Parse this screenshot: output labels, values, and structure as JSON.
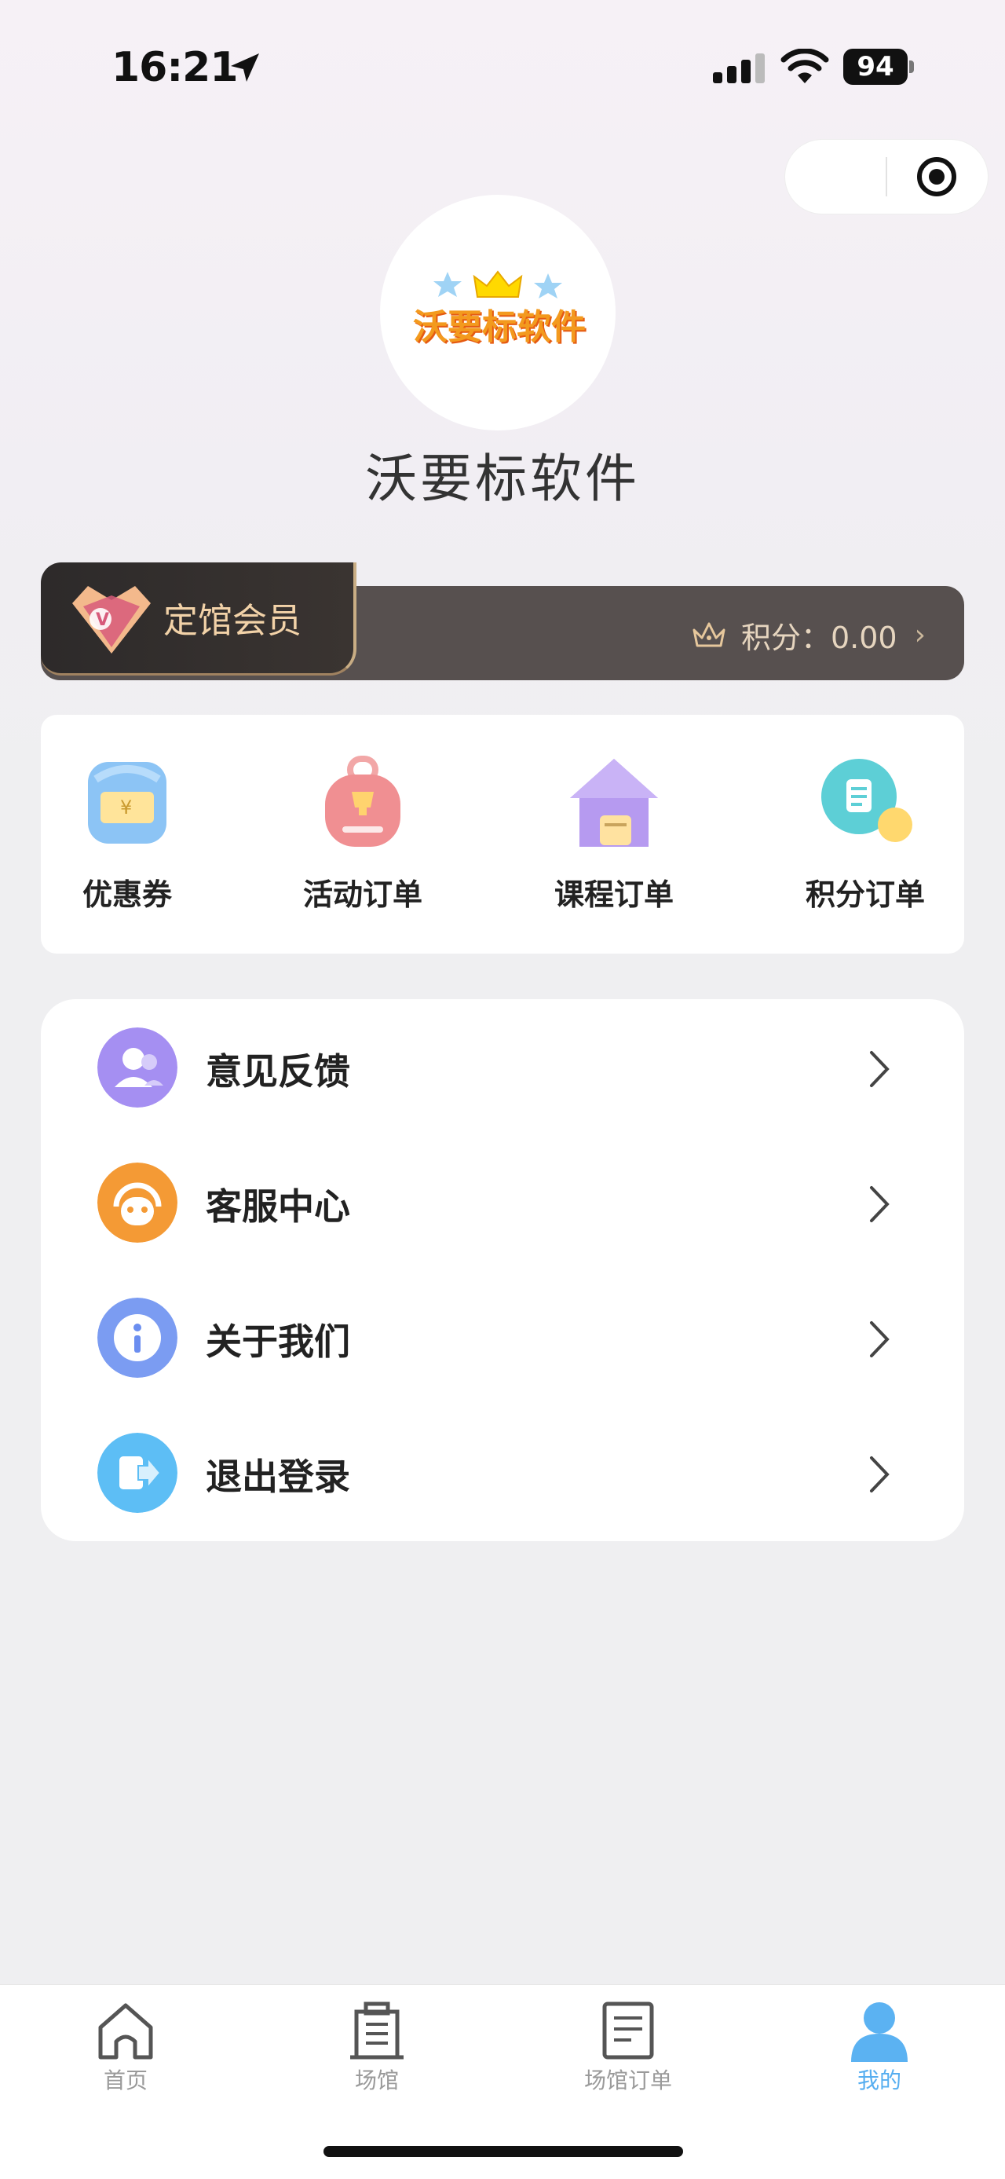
{
  "status_bar": {
    "time": "16:21",
    "battery": "94"
  },
  "header": {
    "app_name": "沃要标软件",
    "logo_text": "沃要标软件"
  },
  "member": {
    "title": "定馆会员",
    "points": "积分：0.00"
  },
  "quick_menu": [
    {
      "label": "优惠券",
      "icon": "coupon-icon"
    },
    {
      "label": "活动订单",
      "icon": "activity-order-icon"
    },
    {
      "label": "课程订单",
      "icon": "course-order-icon"
    },
    {
      "label": "积分订单",
      "icon": "points-order-icon"
    }
  ],
  "menu_list": [
    {
      "label": "意见反馈",
      "icon": "feedback-icon"
    },
    {
      "label": "客服中心",
      "icon": "customer-service-icon"
    },
    {
      "label": "关于我们",
      "icon": "info-icon"
    },
    {
      "label": "退出登录",
      "icon": "logout-icon"
    }
  ],
  "tabbar": [
    {
      "label": "首页",
      "icon": "home-icon",
      "active": false
    },
    {
      "label": "场馆",
      "icon": "venue-icon",
      "active": false
    },
    {
      "label": "场馆订单",
      "icon": "venue-order-icon",
      "active": false
    },
    {
      "label": "我的",
      "icon": "profile-icon",
      "active": true
    }
  ],
  "colors": {
    "accent": "#56aef0",
    "member_bar": "#57504f",
    "member_text": "#f2d2a8"
  }
}
